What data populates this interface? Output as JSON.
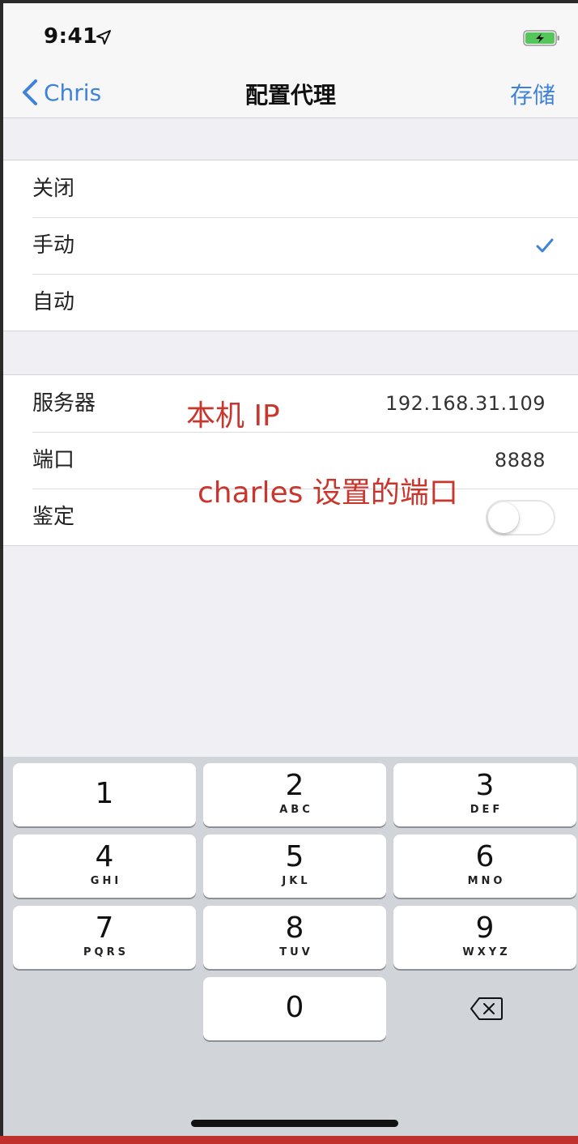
{
  "status_bar": {
    "time": "9:41"
  },
  "nav": {
    "back_label": "Chris",
    "title": "配置代理",
    "save_label": "存储"
  },
  "proxy_modes": [
    {
      "label": "关闭",
      "selected": false
    },
    {
      "label": "手动",
      "selected": true
    },
    {
      "label": "自动",
      "selected": false
    }
  ],
  "settings": {
    "server": {
      "label": "服务器",
      "value": "192.168.31.109"
    },
    "port": {
      "label": "端口",
      "value": "8888"
    },
    "auth": {
      "label": "鉴定",
      "enabled": false
    }
  },
  "annotations": {
    "server_note": "本机 IP",
    "port_note": "charles 设置的端口"
  },
  "keypad": {
    "keys": [
      {
        "digit": "1",
        "letters": ""
      },
      {
        "digit": "2",
        "letters": "ABC"
      },
      {
        "digit": "3",
        "letters": "DEF"
      },
      {
        "digit": "4",
        "letters": "GHI"
      },
      {
        "digit": "5",
        "letters": "JKL"
      },
      {
        "digit": "6",
        "letters": "MNO"
      },
      {
        "digit": "7",
        "letters": "PQRS"
      },
      {
        "digit": "8",
        "letters": "TUV"
      },
      {
        "digit": "9",
        "letters": "WXYZ"
      },
      {
        "digit": "0",
        "letters": ""
      }
    ]
  },
  "colors": {
    "accent": "#3f83d8",
    "annotation": "#c8362e",
    "background": "#efeff4"
  }
}
